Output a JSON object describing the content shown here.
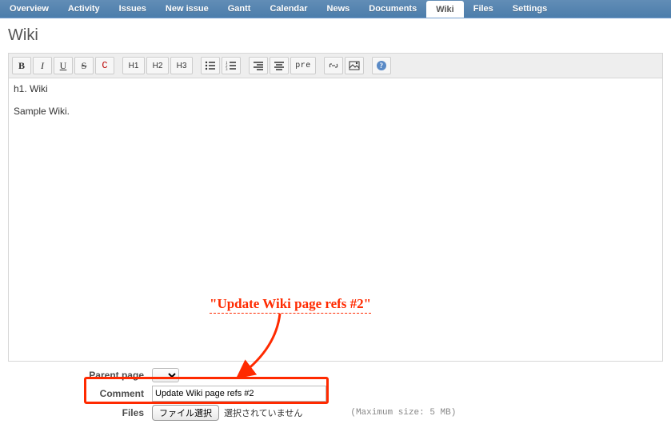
{
  "tabs": {
    "items": [
      {
        "label": "Overview"
      },
      {
        "label": "Activity"
      },
      {
        "label": "Issues"
      },
      {
        "label": "New issue"
      },
      {
        "label": "Gantt"
      },
      {
        "label": "Calendar"
      },
      {
        "label": "News"
      },
      {
        "label": "Documents"
      },
      {
        "label": "Wiki",
        "active": true
      },
      {
        "label": "Files"
      },
      {
        "label": "Settings"
      }
    ]
  },
  "page": {
    "title": "Wiki"
  },
  "toolbar": {
    "groups": [
      [
        {
          "name": "bold-button",
          "label": "B",
          "style": "font-weight:bold"
        },
        {
          "name": "italic-button",
          "label": "I",
          "style": "font-style:italic"
        },
        {
          "name": "underline-button",
          "label": "U",
          "style": "text-decoration:underline"
        },
        {
          "name": "strike-button",
          "label": "S",
          "style": "text-decoration:line-through"
        },
        {
          "name": "inline-code-button",
          "label": "C",
          "style": "font-family:monospace;color:#b00"
        }
      ],
      [
        {
          "name": "heading1-button",
          "label": "H1",
          "wide": true
        },
        {
          "name": "heading2-button",
          "label": "H2",
          "wide": true
        },
        {
          "name": "heading3-button",
          "label": "H3",
          "wide": true
        }
      ],
      [
        {
          "name": "unordered-list-button",
          "icon": "ul"
        },
        {
          "name": "ordered-list-button",
          "icon": "ol"
        }
      ],
      [
        {
          "name": "align-right-button",
          "icon": "align-right"
        },
        {
          "name": "align-center-button",
          "icon": "align-center"
        },
        {
          "name": "preformatted-button",
          "label": "pre",
          "pre": true
        }
      ],
      [
        {
          "name": "link-button",
          "icon": "link"
        },
        {
          "name": "image-button",
          "icon": "image"
        }
      ],
      [
        {
          "name": "help-button",
          "icon": "help"
        }
      ]
    ]
  },
  "editor": {
    "content": "h1. Wiki\n\nSample Wiki."
  },
  "form": {
    "parent_page": {
      "label": "Parent page"
    },
    "comment": {
      "label": "Comment",
      "value": "Update Wiki page refs #2"
    },
    "files": {
      "label": "Files",
      "button": "ファイル選択",
      "status": "選択されていません",
      "hint": "(Maximum size: 5 MB)"
    }
  },
  "annotation": {
    "text": "\"Update Wiki page refs #2\""
  }
}
